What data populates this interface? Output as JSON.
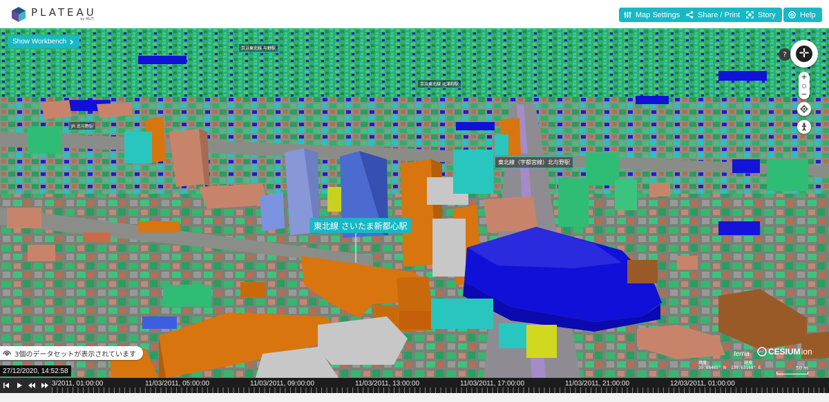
{
  "header": {
    "logo_name": "PLATEAU",
    "logo_sub": "by MLIT",
    "buttons": [
      {
        "label": "Map Settings",
        "icon": "sliders-icon"
      },
      {
        "label": "Share / Print",
        "icon": "share-icon"
      },
      {
        "label": "Story",
        "icon": "story-icon"
      },
      {
        "label": "Help",
        "icon": "help-icon"
      }
    ]
  },
  "workbench": {
    "show_label": "Show Workbench",
    "icon": "chevron-right-icon"
  },
  "navigation": {
    "help": "?",
    "zoom_in": "+",
    "zoom_reset": "○",
    "zoom_out": "−"
  },
  "callouts": {
    "main": "東北線 さいたま新都心駅",
    "secondary": "東北線（宇都宮線）北与野駅",
    "small1": "京浜東北線 与野駅",
    "small2": "京浜東北線 北浦和駅",
    "small3": "JR 北与野駅"
  },
  "status": {
    "datasets": "3個のデータセットが表示されています"
  },
  "clock": "27/12/2020, 14:52:58",
  "timeline": {
    "labels": [
      "3/2011, 01:00:00",
      "11/03/2011, 05:00:00",
      "11/03/2011, 09:00:00",
      "11/03/2011, 13:00:00",
      "11/03/2011, 17:00:00",
      "11/03/2011, 21:00:00",
      "12/03/2011, 01:00:00"
    ]
  },
  "credits": {
    "terria": "terria",
    "cesium": "CESIUM",
    "cesium_suffix": "ion"
  },
  "coords": {
    "lat_label": "緯度",
    "lat": "35.88465° N",
    "lon_label": "経度",
    "lon": "139.63168° E"
  },
  "scale": "50 m",
  "colors": {
    "accent": "#18b8c4",
    "brand_dark": "#1a4a7a",
    "buildings_green": "#2fae6a",
    "buildings_blue": "#1010d8",
    "buildings_orange": "#d9750e",
    "buildings_brown": "#c8846a"
  }
}
